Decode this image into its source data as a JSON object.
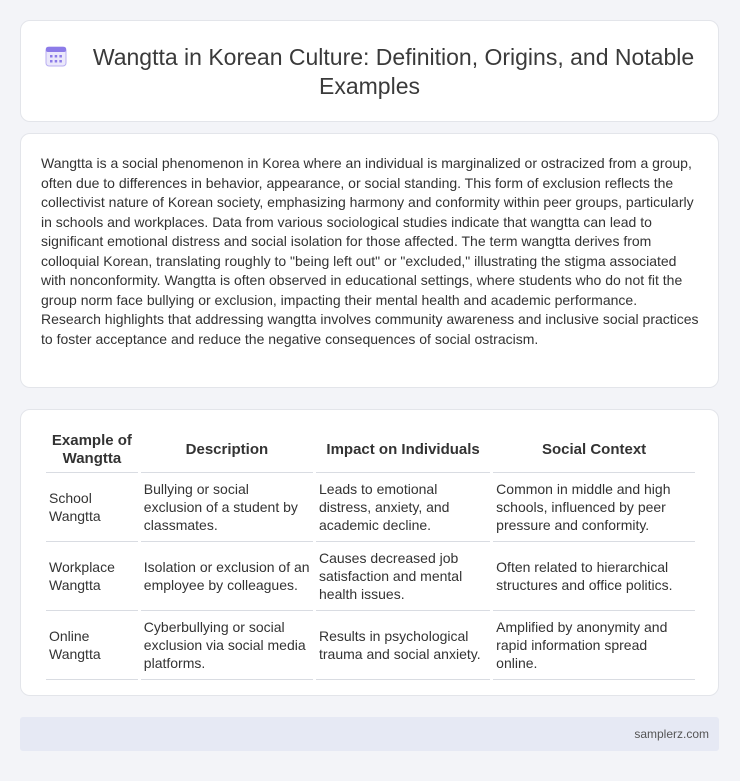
{
  "header": {
    "icon": "calendar-icon",
    "title": "Wangtta in Korean Culture: Definition, Origins, and Notable Examples"
  },
  "description": "Wangtta is a social phenomenon in Korea where an individual is marginalized or ostracized from a group, often due to differences in behavior, appearance, or social standing. This form of exclusion reflects the collectivist nature of Korean society, emphasizing harmony and conformity within peer groups, particularly in schools and workplaces. Data from various sociological studies indicate that wangtta can lead to significant emotional distress and social isolation for those affected. The term wangtta derives from colloquial Korean, translating roughly to \"being left out\" or \"excluded,\" illustrating the stigma associated with nonconformity. Wangtta is often observed in educational settings, where students who do not fit the group norm face bullying or exclusion, impacting their mental health and academic performance. Research highlights that addressing wangtta involves community awareness and inclusive social practices to foster acceptance and reduce the negative consequences of social ostracism.",
  "table": {
    "headers": [
      "Example of Wangtta",
      "Description",
      "Impact on Individuals",
      "Social Context"
    ],
    "rows": [
      [
        "School Wangtta",
        "Bullying or social exclusion of a student by classmates.",
        "Leads to emotional distress, anxiety, and academic decline.",
        "Common in middle and high schools, influenced by peer pressure and conformity."
      ],
      [
        "Workplace Wangtta",
        "Isolation or exclusion of an employee by colleagues.",
        "Causes decreased job satisfaction and mental health issues.",
        "Often related to hierarchical structures and office politics."
      ],
      [
        "Online Wangtta",
        "Cyberbullying or social exclusion via social media platforms.",
        "Results in psychological trauma and social anxiety.",
        "Amplified by anonymity and rapid information spread online."
      ]
    ]
  },
  "footer": {
    "site": "samplerz.com"
  },
  "colors": {
    "page_background": "#f3f4f8",
    "footer_background": "#e6e9f4",
    "icon_accent": "#8c7be8"
  }
}
